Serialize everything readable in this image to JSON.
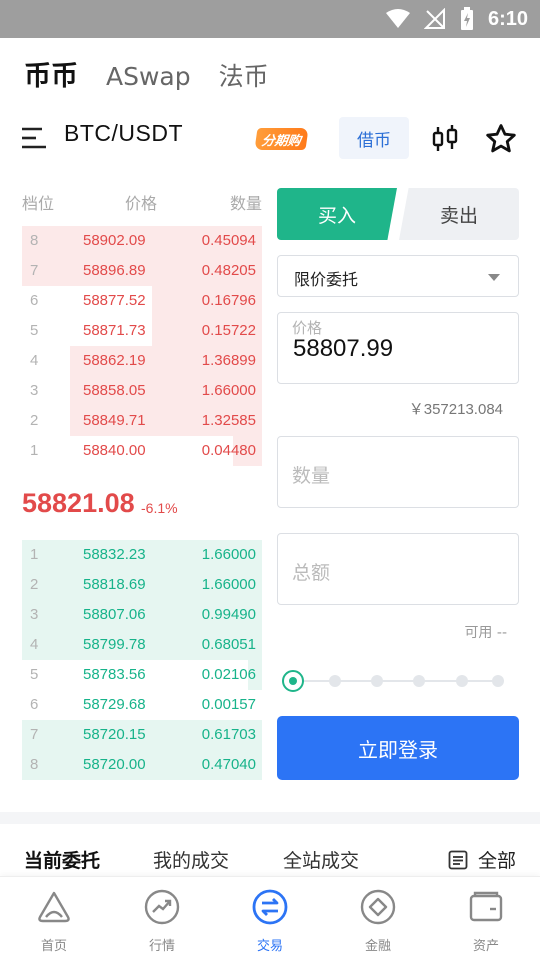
{
  "status_bar": {
    "time": "6:10"
  },
  "top_tabs": [
    "币币",
    "ASwap",
    "法币"
  ],
  "pair": {
    "name": "BTC/USDT",
    "badge": "分期购",
    "borrow": "借币"
  },
  "orderbook": {
    "headers": {
      "level": "档位",
      "price": "价格",
      "qty": "数量"
    },
    "asks": [
      {
        "level": "8",
        "price": "58902.09",
        "qty": "0.45094",
        "depth": 1.0
      },
      {
        "level": "7",
        "price": "58896.89",
        "qty": "0.48205",
        "depth": 1.0
      },
      {
        "level": "6",
        "price": "58877.52",
        "qty": "0.16796",
        "depth": 0.46
      },
      {
        "level": "5",
        "price": "58871.73",
        "qty": "0.15722",
        "depth": 0.46
      },
      {
        "level": "4",
        "price": "58862.19",
        "qty": "1.36899",
        "depth": 0.8
      },
      {
        "level": "3",
        "price": "58858.05",
        "qty": "1.66000",
        "depth": 0.8
      },
      {
        "level": "2",
        "price": "58849.71",
        "qty": "1.32585",
        "depth": 0.8
      },
      {
        "level": "1",
        "price": "58840.00",
        "qty": "0.04480",
        "depth": 0.12
      }
    ],
    "last_price": "58821.08",
    "last_change": "-6.1%",
    "bids": [
      {
        "level": "1",
        "price": "58832.23",
        "qty": "1.66000",
        "depth": 1.0
      },
      {
        "level": "2",
        "price": "58818.69",
        "qty": "1.66000",
        "depth": 1.0
      },
      {
        "level": "3",
        "price": "58807.06",
        "qty": "0.99490",
        "depth": 1.0
      },
      {
        "level": "4",
        "price": "58799.78",
        "qty": "0.68051",
        "depth": 1.0
      },
      {
        "level": "5",
        "price": "58783.56",
        "qty": "0.02106",
        "depth": 0.06
      },
      {
        "level": "6",
        "price": "58729.68",
        "qty": "0.00157",
        "depth": 0.0
      },
      {
        "level": "7",
        "price": "58720.15",
        "qty": "0.61703",
        "depth": 1.0
      },
      {
        "level": "8",
        "price": "58720.00",
        "qty": "0.47040",
        "depth": 1.0
      }
    ]
  },
  "order_form": {
    "buy": "买入",
    "sell": "卖出",
    "order_type": "限价委托",
    "price_label": "价格",
    "price_value": "58807.99",
    "cny_value": "￥357213.084",
    "qty_placeholder": "数量",
    "total_placeholder": "总额",
    "available": "可用 --",
    "login": "立即登录"
  },
  "order_tabs": {
    "current": "当前委托",
    "mine": "我的成交",
    "all_trades": "全站成交",
    "all": "全部"
  },
  "nav": [
    "首页",
    "行情",
    "交易",
    "金融",
    "资产"
  ],
  "colors": {
    "buy": "#1fb58a",
    "sell": "#e24a4a",
    "primary": "#2c74f5"
  }
}
